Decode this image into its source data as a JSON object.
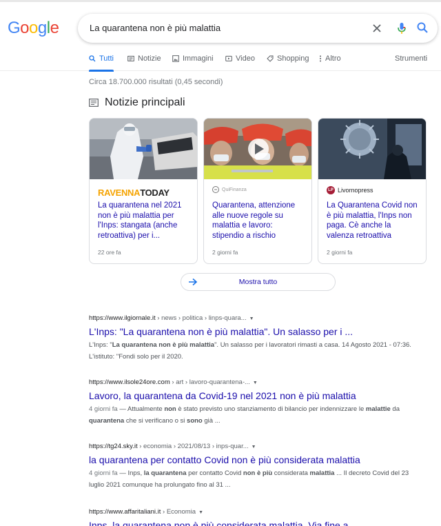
{
  "brand": {
    "logo_letters": [
      {
        "ch": "G",
        "color": "#4285f4"
      },
      {
        "ch": "o",
        "color": "#ea4335"
      },
      {
        "ch": "o",
        "color": "#fbbc05"
      },
      {
        "ch": "g",
        "color": "#4285f4"
      },
      {
        "ch": "l",
        "color": "#34a853"
      },
      {
        "ch": "e",
        "color": "#ea4335"
      }
    ]
  },
  "search": {
    "query": "La quarantena non è più malattia",
    "icons": [
      "close-icon",
      "mic-icon",
      "search-icon"
    ]
  },
  "tabs": [
    {
      "label": "Tutti",
      "icon": "search-icon",
      "active": true
    },
    {
      "label": "Notizie",
      "icon": "news-icon",
      "active": false
    },
    {
      "label": "Immagini",
      "icon": "image-icon",
      "active": false
    },
    {
      "label": "Video",
      "icon": "video-icon",
      "active": false
    },
    {
      "label": "Shopping",
      "icon": "tag-icon",
      "active": false
    },
    {
      "label": "Altro",
      "icon": "more-vert-icon",
      "active": false
    }
  ],
  "tools_label": "Strumenti",
  "stats": "Circa 18.700.000 risultati (0,45 secondi)",
  "top_stories": {
    "title": "Notizie principali",
    "cards": [
      {
        "source": "RAVENNATODAY",
        "source_parts": [
          "RAVENNA",
          "TODAY"
        ],
        "headline": "La quarantena nel 2021 non è più malattia per l'Inps: stangata (anche retroattiva) per i...",
        "age": "22 ore fa"
      },
      {
        "source": "QuiFinanza",
        "headline": "Quarantena, attenzione alle nuove regole su malattia e lavoro: stipendio a rischio",
        "age": "2 giorni fa"
      },
      {
        "source": "Livornopress",
        "source_badge": "LP",
        "headline": "La Quarantena Covid non è più malattia, l'Inps non paga. Cè anche la valenza retroattiva",
        "age": "2 giorni fa"
      }
    ],
    "more_label": "Mostra tutto"
  },
  "results": [
    {
      "domain": "https://www.ilgiornale.it",
      "path": " › news › politica › linps-quara...",
      "title": "L'Inps: \"La quarantena non è più malattia\". Un salasso per i ...",
      "snippet_html": "L'Inps: \"<b>La quarantena non è più malattia</b>\". Un salasso per i lavoratori rimasti a casa. 14 Agosto 2021 - 07:36. L'istituto: \"Fondi solo per il 2020."
    },
    {
      "domain": "https://www.ilsole24ore.com",
      "path": " › art › lavoro-quarantena-...",
      "title": "Lavoro, la quarantena da Covid-19 nel 2021 non è più malattia",
      "snippet_html": "<span class=\"date\">4 giorni fa</span> — Attualmente <b>non</b> è stato previsto uno stanziamento di bilancio per indennizzare le <b>malattie</b> da <b>quarantena</b> che si verificano o si <b>sono</b> già ..."
    },
    {
      "domain": "https://tg24.sky.it",
      "path": " › economia › 2021/08/13 › inps-quar...",
      "title": "la quarantena per contatto Covid non è più considerata malattia",
      "snippet_html": "<span class=\"date\">4 giorni fa</span> — Inps, <b>la quarantena</b> per contatto Covid <b>non è più</b> considerata <b>malattia</b> ... Il decreto Covid del 23 luglio 2021 comunque ha prolungato fino al 31 ..."
    },
    {
      "domain": "https://www.affaritaliani.it",
      "path": " › Economia",
      "title": "Inps, la quarantena non è più considerata malattia. Via fine a ...",
      "snippet_html": ""
    }
  ]
}
